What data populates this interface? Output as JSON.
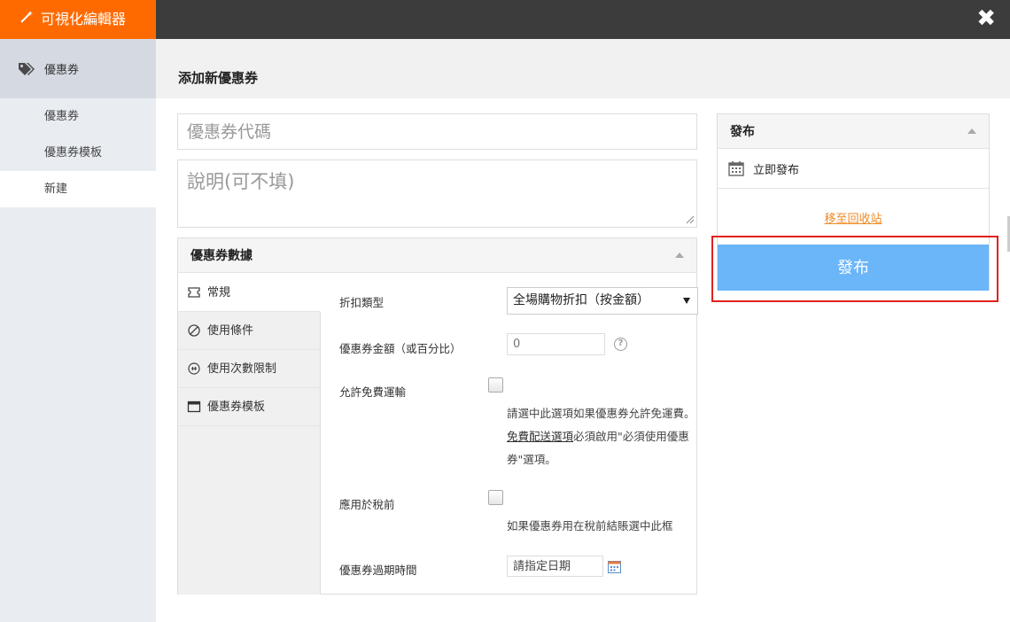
{
  "app": {
    "brand_title": "可視化編輯器",
    "close_label": "✖"
  },
  "sidebar": {
    "section_label": "優惠券",
    "items": [
      {
        "label": "優惠券"
      },
      {
        "label": "優惠券模板"
      },
      {
        "label": "新建"
      }
    ]
  },
  "page": {
    "title": "添加新優惠券"
  },
  "form": {
    "code_placeholder": "優惠券代碼",
    "description_placeholder": "說明(可不填)"
  },
  "coupon_data": {
    "title": "優惠券數據",
    "tabs": [
      {
        "label": "常規"
      },
      {
        "label": "使用條件"
      },
      {
        "label": "使用次數限制"
      },
      {
        "label": "優惠券模板"
      }
    ],
    "discount_type_label": "折扣類型",
    "discount_type_value": "全場購物折扣（按金額）",
    "amount_label": "優惠券金額（或百分比）",
    "amount_placeholder": "0",
    "free_shipping_label": "允許免費運輸",
    "free_shipping_checked": false,
    "free_shipping_hint_1": "請選中此選項如果優惠券允許免運費。",
    "free_shipping_hint_link": "免費配送選項",
    "free_shipping_hint_2": "必須啟用\"必須使用優惠券\"選項。",
    "pre_tax_label": "應用於稅前",
    "pre_tax_checked": false,
    "pre_tax_hint": "如果優惠券用在稅前結賬選中此框",
    "expiry_label": "優惠券過期時間",
    "expiry_placeholder": "請指定日期"
  },
  "publish": {
    "title": "發布",
    "publish_now": "立即發布",
    "trash_link": "移至回收站",
    "button_label": "發布"
  },
  "colors": {
    "brand": "#ff6a00",
    "topbar": "#3c3c3c",
    "publish_button": "#6bb5f9",
    "trash_link": "#f08a24",
    "highlight": "#e02020"
  }
}
